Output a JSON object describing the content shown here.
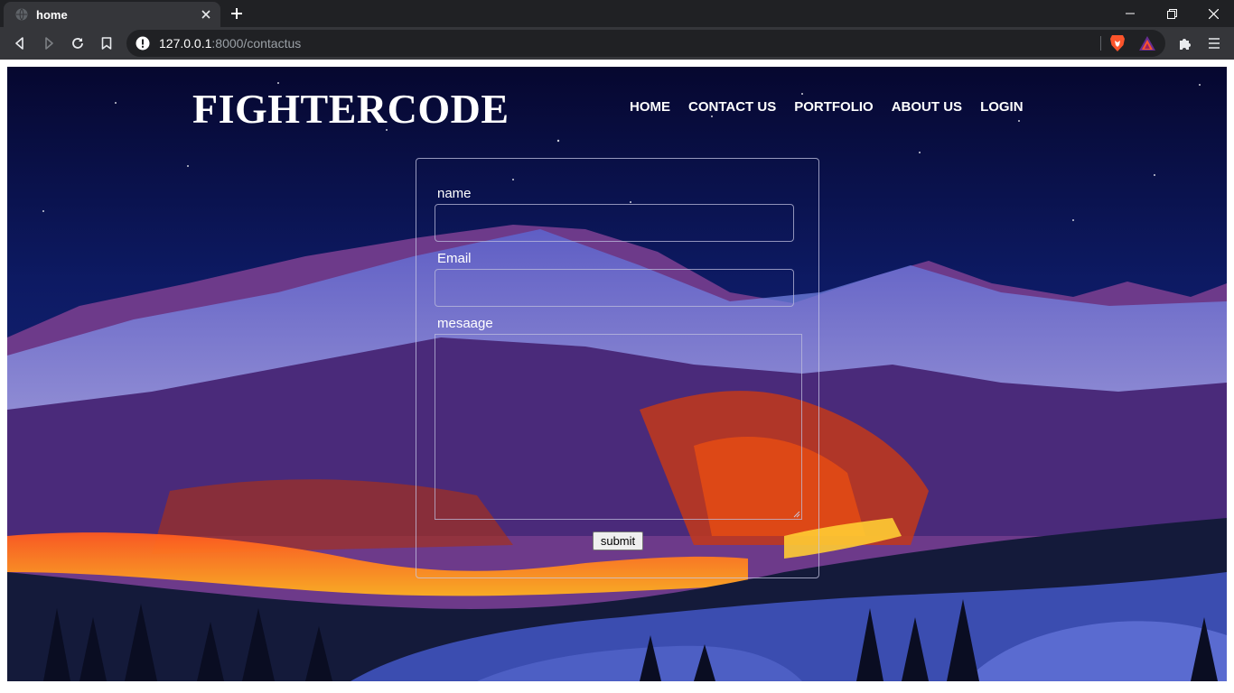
{
  "browser": {
    "tab_title": "home",
    "url_host": "127.0.0.1",
    "url_path": ":8000/contactus",
    "colors": {
      "tabstrip": "#202124",
      "toolbar": "#35363a",
      "brave_orange": "#fb542b"
    }
  },
  "site": {
    "brand": "FIGHTERCODE",
    "nav": [
      "HOME",
      "CONTACT US",
      "PORTFOLIO",
      "ABOUT US",
      "LOGIN"
    ]
  },
  "form": {
    "name_label": "name",
    "name_value": "",
    "email_label": "Email",
    "email_value": "",
    "message_label": "mesaage",
    "message_value": "",
    "submit_label": "submit"
  },
  "icons": [
    "globe-icon",
    "close-icon",
    "plus-icon",
    "minimize-icon",
    "restore-icon",
    "back-icon",
    "forward-icon",
    "reload-icon",
    "bookmark-icon",
    "info-icon",
    "brave-lion-icon",
    "brave-rewards-icon",
    "extensions-icon",
    "menu-icon"
  ]
}
